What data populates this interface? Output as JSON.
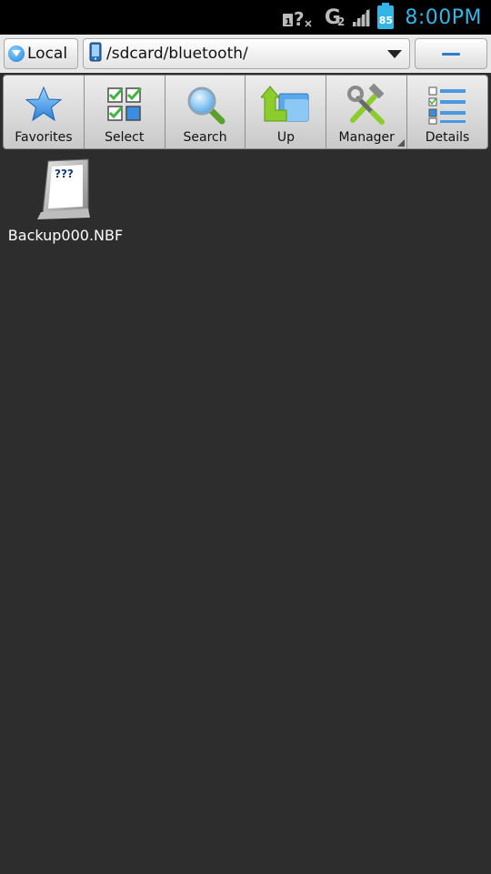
{
  "status_bar": {
    "time": "8:00PM",
    "battery_level": "85",
    "network_letter": "G",
    "network_sub": "2",
    "sim_label": "1",
    "colors": {
      "accent": "#33b5e5"
    }
  },
  "address_bar": {
    "location_label": "Local",
    "path": "/sdcard/bluetooth/"
  },
  "toolbar": {
    "items": [
      {
        "label": "Favorites",
        "icon": "star-icon"
      },
      {
        "label": "Select",
        "icon": "checklist-icon"
      },
      {
        "label": "Search",
        "icon": "magnifier-icon"
      },
      {
        "label": "Up",
        "icon": "folder-up-icon"
      },
      {
        "label": "Manager",
        "icon": "tools-icon"
      },
      {
        "label": "Details",
        "icon": "list-details-icon"
      }
    ]
  },
  "files": [
    {
      "name": "Backup000.NBF",
      "icon": "unknown-file-icon"
    }
  ]
}
